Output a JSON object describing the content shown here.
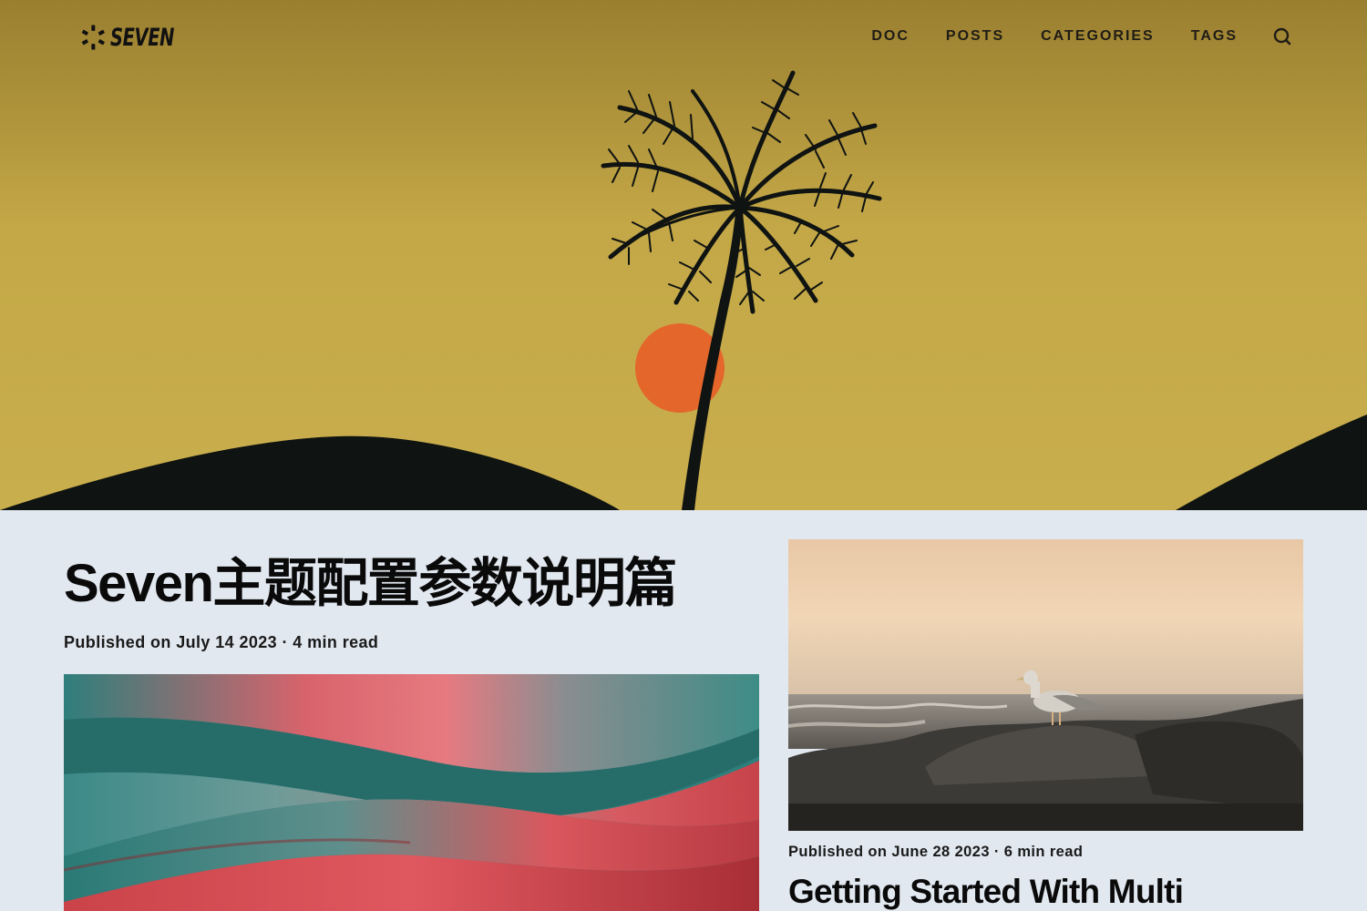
{
  "site": {
    "brand": "SEVEN"
  },
  "nav": {
    "items": [
      {
        "label": "DOC"
      },
      {
        "label": "POSTS"
      },
      {
        "label": "CATEGORIES"
      },
      {
        "label": "TAGS"
      }
    ],
    "search_icon": "search-icon"
  },
  "hero": {
    "image": "palm-tree-sunset-illustration",
    "colors": {
      "sky_top": "#9c8230",
      "sky_bottom": "#c9ad4a",
      "sun": "#e86a26",
      "silhouette": "#0f1311"
    }
  },
  "featured_post": {
    "title": "Seven主题配置参数说明篇",
    "meta": "Published on July 14 2023 · 4 min read",
    "image": "abstract-red-teal-waves"
  },
  "side_post": {
    "meta": "Published on June 28 2023 · 6 min read",
    "title": "Getting Started With Multi",
    "image": "seagull-on-rocks-at-sunset"
  },
  "colors": {
    "page_background": "#e2e8f0",
    "text": "#0a0a0a"
  }
}
